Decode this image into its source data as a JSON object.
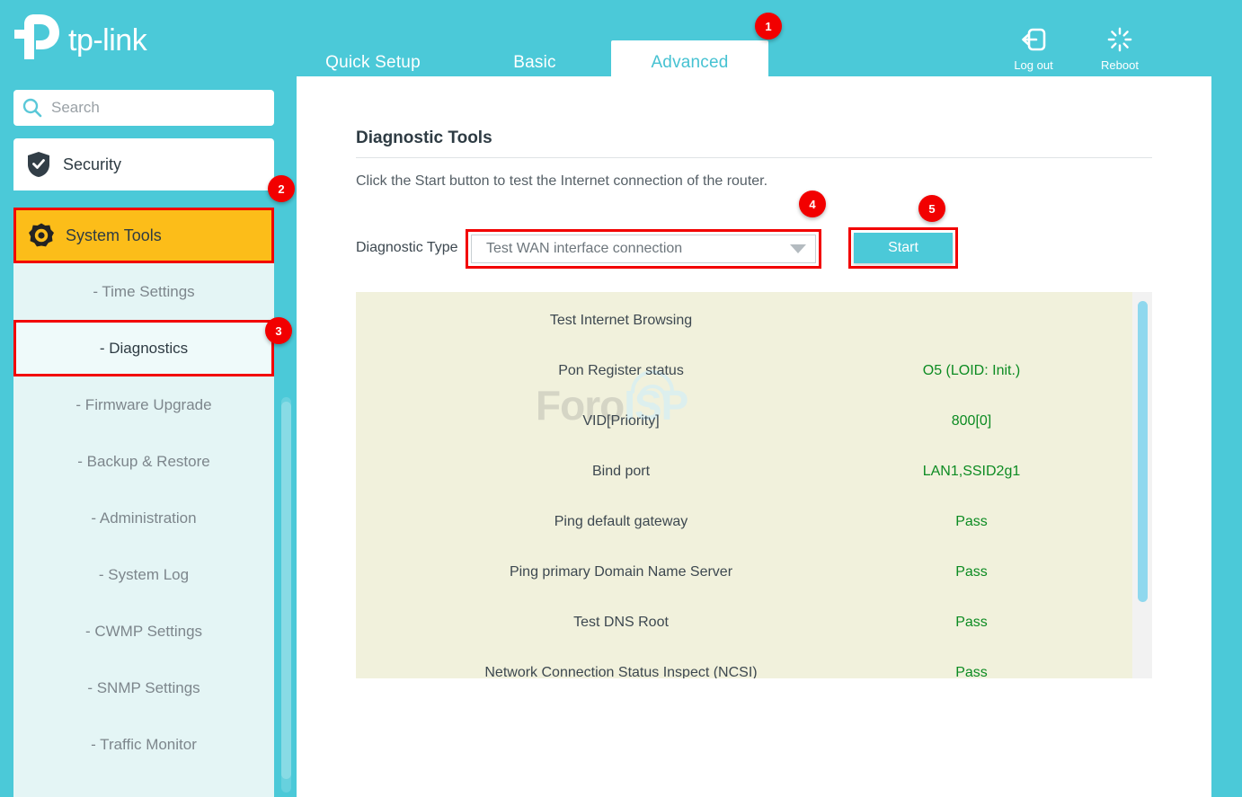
{
  "brand": {
    "name": "tp-link"
  },
  "header": {
    "tabs": [
      {
        "label": "Quick Setup",
        "active": false
      },
      {
        "label": "Basic",
        "active": false
      },
      {
        "label": "Advanced",
        "active": true
      }
    ],
    "actions": [
      {
        "label": "Log out",
        "icon": "logout-icon"
      },
      {
        "label": "Reboot",
        "icon": "reboot-icon"
      }
    ]
  },
  "sidebar": {
    "search": {
      "placeholder": "Search",
      "value": "",
      "icon": "search-icon"
    },
    "menu": [
      {
        "label": "Security",
        "icon": "shield-check-icon",
        "active": false
      },
      {
        "label": "System Tools",
        "icon": "gear-icon",
        "active": true
      }
    ],
    "submenu": [
      {
        "label": "- Time Settings",
        "active": false
      },
      {
        "label": "- Diagnostics",
        "active": true
      },
      {
        "label": "- Firmware Upgrade",
        "active": false
      },
      {
        "label": "- Backup & Restore",
        "active": false
      },
      {
        "label": "- Administration",
        "active": false
      },
      {
        "label": "- System Log",
        "active": false
      },
      {
        "label": "- CWMP Settings",
        "active": false
      },
      {
        "label": "- SNMP Settings",
        "active": false
      },
      {
        "label": "- Traffic Monitor",
        "active": false
      }
    ]
  },
  "main": {
    "page_title": "Diagnostic Tools",
    "description": "Click the Start button to test the Internet connection of the router.",
    "form": {
      "diagnostic_type_label": "Diagnostic Type",
      "diagnostic_type_value": "Test WAN interface connection",
      "diagnostic_type_options": [
        "Test WAN interface connection"
      ],
      "start_label": "Start"
    },
    "results": [
      {
        "name": "Test Internet Browsing",
        "value": ""
      },
      {
        "name": "Pon Register status",
        "value": "O5 (LOID: Init.)"
      },
      {
        "name": "VID[Priority]",
        "value": "800[0]"
      },
      {
        "name": "Bind port",
        "value": "LAN1,SSID2g1"
      },
      {
        "name": "Ping default gateway",
        "value": "Pass"
      },
      {
        "name": "Ping primary Domain Name Server",
        "value": "Pass"
      },
      {
        "name": "Test DNS Root",
        "value": "Pass"
      },
      {
        "name": "Network Connection Status Inspect (NCSI)",
        "value": "Pass"
      }
    ]
  },
  "watermark": {
    "part1": "Foro",
    "part2": "ISP"
  },
  "annotations": [
    {
      "number": "1",
      "target": "tab-advanced"
    },
    {
      "number": "2",
      "target": "sidebar-item-system-tools"
    },
    {
      "number": "3",
      "target": "sidebar-item-diagnostics"
    },
    {
      "number": "4",
      "target": "diagnostic-type-select"
    },
    {
      "number": "5",
      "target": "start-button"
    }
  ],
  "colors": {
    "brand_teal": "#4bc9d8",
    "accent_yellow": "#fcbd19",
    "annotation_red": "#f20000",
    "pass_green": "#0c8b22",
    "results_bg": "#f1f1dc"
  }
}
